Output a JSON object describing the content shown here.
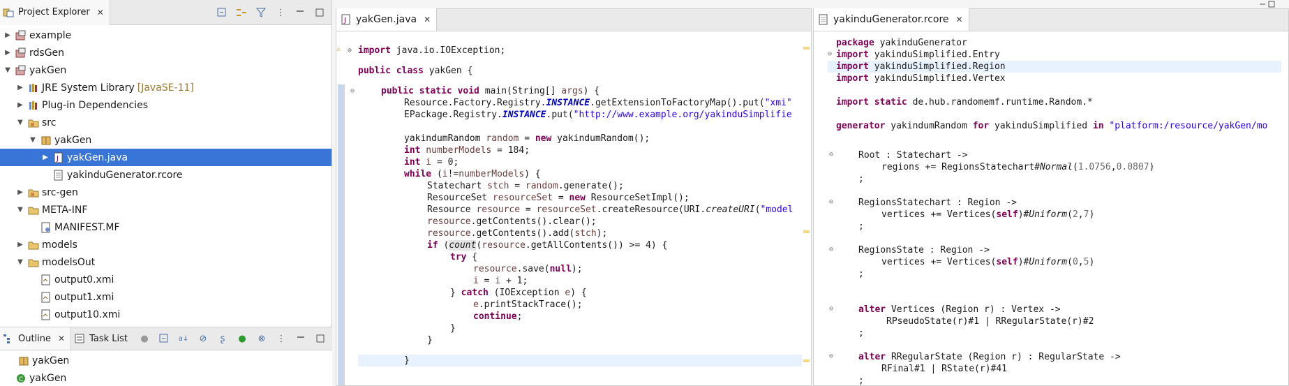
{
  "project_explorer": {
    "title": "Project Explorer",
    "close": "✕",
    "items": [
      {
        "label": "example",
        "decoration": ""
      },
      {
        "label": "rdsGen",
        "decoration": ""
      },
      {
        "label": "yakGen",
        "decoration": ""
      },
      {
        "label": "JRE System Library",
        "decoration": "[JavaSE-11]"
      },
      {
        "label": "Plug-in Dependencies",
        "decoration": ""
      },
      {
        "label": "src",
        "decoration": ""
      },
      {
        "label": "yakGen",
        "decoration": ""
      },
      {
        "label": "yakGen.java",
        "decoration": ""
      },
      {
        "label": "yakinduGenerator.rcore",
        "decoration": ""
      },
      {
        "label": "src-gen",
        "decoration": ""
      },
      {
        "label": "META-INF",
        "decoration": ""
      },
      {
        "label": "MANIFEST.MF",
        "decoration": ""
      },
      {
        "label": "models",
        "decoration": ""
      },
      {
        "label": "modelsOut",
        "decoration": ""
      },
      {
        "label": "output0.xmi",
        "decoration": ""
      },
      {
        "label": "output1.xmi",
        "decoration": ""
      },
      {
        "label": "output10.xmi",
        "decoration": ""
      }
    ]
  },
  "outline": {
    "title": "Outline",
    "task_list": "Task List",
    "items": [
      {
        "label": "yakGen"
      },
      {
        "label": "yakGen"
      }
    ]
  },
  "editor_java": {
    "tab": "yakGen.java",
    "lines": {
      "l1a": "import",
      "l1b": " java.io.IOException;",
      "l2a": "public class",
      "l2b": " yakGen {",
      "l3a": "public static void",
      "l3b": " main(String[] ",
      "l3c": "args",
      "l3d": ") {",
      "l4a": "Resource.Factory.Registry.",
      "l4b": "INSTANCE",
      "l4c": ".getExtensionToFactoryMap().put(",
      "l4d": "\"xmi\"",
      "l5a": "EPackage.Registry.",
      "l5b": "INSTANCE",
      "l5c": ".put(",
      "l5d": "\"http://www.example.org/yakinduSimplifie",
      "l6a": "yakindumRandom ",
      "l6b": "random",
      "l6c": " = ",
      "l6d": "new",
      "l6e": " yakindumRandom();",
      "l7a": "int",
      "l7b": " numberModels",
      "l7c": " = 184;",
      "l8a": "int",
      "l8b": " i",
      "l8c": " = 0;",
      "l9a": "while",
      "l9b": " (",
      "l9c": "i",
      "l9d": "!=",
      "l9e": "numberModels",
      "l9f": ") {",
      "l10a": "Statechart ",
      "l10b": "stch",
      "l10c": " = ",
      "l10d": "random",
      "l10e": ".generate();",
      "l11a": "ResourceSet ",
      "l11b": "resourceSet",
      "l11c": " = ",
      "l11d": "new",
      "l11e": " ResourceSetImpl();",
      "l12a": "Resource ",
      "l12b": "resource",
      "l12c": " = ",
      "l12d": "resourceSet",
      "l12e": ".createResource(URI.",
      "l12f": "createURI",
      "l12g": "(",
      "l12h": "\"model",
      "l13a": "resource",
      "l13b": ".getContents().clear();",
      "l14a": "resource",
      "l14b": ".getContents().add(",
      "l14c": "stch",
      "l14d": ");",
      "l15a": "if",
      "l15b": " (",
      "l15c": "count",
      "l15d": "(",
      "l15e": "resource",
      "l15f": ".getAllContents()) >= 4) {",
      "l16a": "try",
      "l16b": " {",
      "l17a": "resource",
      "l17b": ".save(",
      "l17c": "null",
      "l17d": ");",
      "l18a": "i",
      "l18b": " = ",
      "l18c": "i",
      "l18d": " + 1;",
      "l19a": "} ",
      "l19b": "catch",
      "l19c": " (IOException ",
      "l19d": "e",
      "l19e": ") {",
      "l20a": "e",
      "l20b": ".printStackTrace();",
      "l21a": "continue",
      "l21b": ";",
      "l22": "}",
      "l23": "}",
      "l24": "}"
    }
  },
  "editor_rcore": {
    "tab": "yakinduGenerator.rcore",
    "lines": {
      "p1a": "package",
      "p1b": " yakinduGenerator",
      "i1a": "import",
      "i1b": " yakinduSimplified.Entry",
      "i2a": "import",
      "i2b": " yakinduSimplified.Region",
      "i3a": "import",
      "i3b": " yakinduSimplified.Vertex",
      "i4a": "import static",
      "i4b": " de.hub.randomemf.runtime.Random.*",
      "g1a": "generator",
      "g1b": " yakindumRandom ",
      "g1c": "for",
      "g1d": " yakinduSimplified ",
      "g1e": "in",
      "g1f": " \"platform:/resource/yakGen/mo",
      "r1": "Root : Statechart ->",
      "r2a": "regions += RegionsStatechart#",
      "r2b": "Normal",
      "r2c": "(",
      "r2d": "1.0756",
      "r2e": ",",
      "r2f": "0.0807",
      "r2g": ")",
      "r3": ";",
      "s1": "RegionsStatechart : Region ->",
      "s2a": "vertices += Vertices(",
      "s2b": "self",
      "s2c": ")#",
      "s2d": "Uniform",
      "s2e": "(",
      "s2f": "2",
      "s2g": ",",
      "s2h": "7",
      "s2i": ")",
      "s3": ";",
      "t1": "RegionsState : Region ->",
      "t2a": "vertices += Vertices(",
      "t2b": "self",
      "t2c": ")#",
      "t2d": "Uniform",
      "t2e": "(",
      "t2f": "0",
      "t2g": ",",
      "t2h": "5",
      "t2i": ")",
      "t3": ";",
      "a1a": "alter",
      "a1b": " Vertices (Region r) : Vertex ->",
      "a2": "RPseudoState(r)#1 | RRegularState(r)#2",
      "a3": ";",
      "b1a": "alter",
      "b1b": " RRegularState (Region r) : RegularState ->",
      "b2": "RFinal#1 | RState(r)#41",
      "b3": ";"
    }
  },
  "colors": {
    "selection": "#3875d7",
    "keyword": "#7f0055",
    "string": "#2a00ff",
    "field": "#0000c0",
    "local_var": "#6a3e3e"
  }
}
